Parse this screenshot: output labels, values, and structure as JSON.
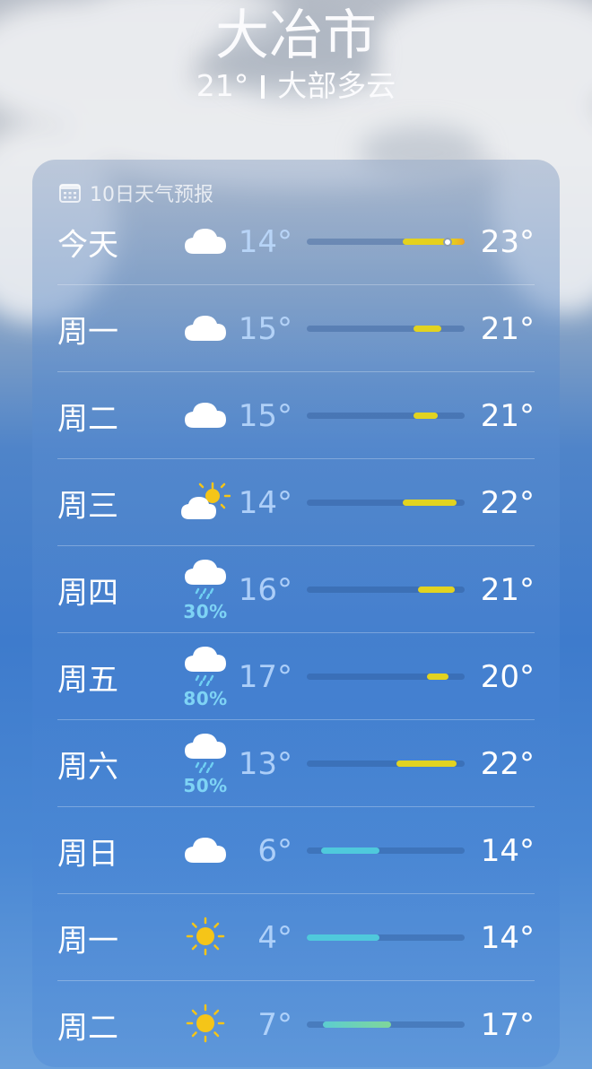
{
  "header": {
    "city": "大冶市",
    "current_temp": "21°",
    "condition": "大部多云"
  },
  "forecast": {
    "title": "10日天气预报",
    "icon": "calendar-icon",
    "range": [
      4,
      23
    ],
    "days": [
      {
        "day": "今天",
        "icon": "cloud-icon",
        "low": "14°",
        "high": "23°",
        "low_val": 14,
        "high_val": 23,
        "fill_from": 15.5,
        "fill_to": 23,
        "current_val": 21,
        "color": "#e6d21e",
        "precip": ""
      },
      {
        "day": "周一",
        "icon": "cloud-icon",
        "low": "15°",
        "high": "21°",
        "low_val": 15,
        "high_val": 21,
        "fill_from": 16.8,
        "fill_to": 20.2,
        "color": "#e2d320",
        "precip": ""
      },
      {
        "day": "周二",
        "icon": "cloud-icon",
        "low": "15°",
        "high": "21°",
        "low_val": 15,
        "high_val": 21,
        "fill_from": 16.8,
        "fill_to": 19.8,
        "color": "#e2d320",
        "precip": ""
      },
      {
        "day": "周三",
        "icon": "partly-sunny-icon",
        "low": "14°",
        "high": "22°",
        "low_val": 14,
        "high_val": 22,
        "fill_from": 15.5,
        "fill_to": 22,
        "color": "#e2d320",
        "precip": ""
      },
      {
        "day": "周四",
        "icon": "rain-cloud-icon",
        "low": "16°",
        "high": "21°",
        "low_val": 16,
        "high_val": 21,
        "fill_from": 17.4,
        "fill_to": 21.8,
        "color": "#e2d320",
        "precip": "30%"
      },
      {
        "day": "周五",
        "icon": "rain-cloud-icon",
        "low": "17°",
        "high": "20°",
        "low_val": 17,
        "high_val": 20,
        "fill_from": 18.5,
        "fill_to": 21.1,
        "color": "#e2d320",
        "precip": "80%"
      },
      {
        "day": "周六",
        "icon": "rain-cloud-icon",
        "low": "13°",
        "high": "22°",
        "low_val": 13,
        "high_val": 22,
        "fill_from": 14.8,
        "fill_to": 22,
        "color": "#e2d320",
        "precip": "50%"
      },
      {
        "day": "周日",
        "icon": "cloud-icon",
        "low": "6°",
        "high": "14°",
        "low_val": 6,
        "high_val": 14,
        "fill_from": 5.7,
        "fill_to": 12.7,
        "color": "#4fc9dc",
        "precip": ""
      },
      {
        "day": "周一",
        "icon": "sun-icon",
        "low": "4°",
        "high": "14°",
        "low_val": 4,
        "high_val": 14,
        "fill_from": 4,
        "fill_to": 12.7,
        "color": "#4fc9dc",
        "precip": ""
      },
      {
        "day": "周二",
        "icon": "sun-icon",
        "low": "7°",
        "high": "17°",
        "low_val": 7,
        "high_val": 17,
        "fill_from": 5.9,
        "fill_to": 14.2,
        "color": "#5ccdd0",
        "color_end": "#7fd69a",
        "precip": ""
      }
    ]
  }
}
